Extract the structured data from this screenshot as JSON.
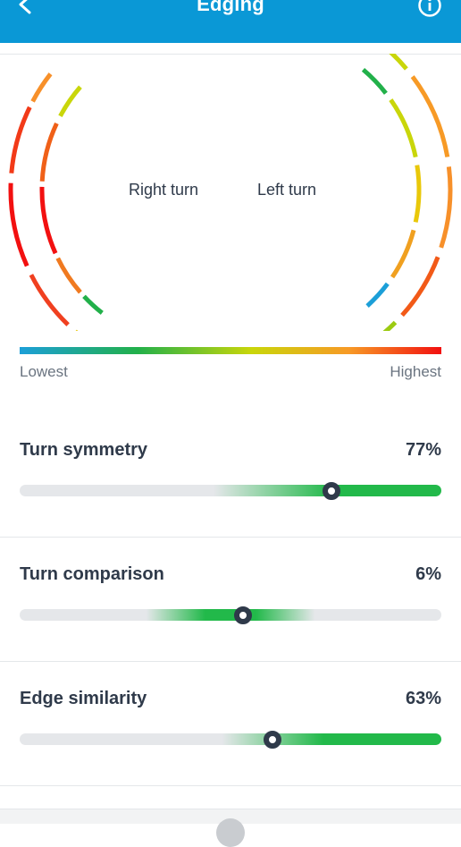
{
  "header": {
    "title": "Edging"
  },
  "gauge": {
    "right_label": "Right turn",
    "left_label": "Left turn"
  },
  "scale": {
    "low_label": "Lowest",
    "high_label": "Highest"
  },
  "metrics": [
    {
      "name": "Turn symmetry",
      "value": "77%",
      "marker_fraction": 0.74
    },
    {
      "name": "Turn comparison",
      "value": "6%",
      "marker_fraction": 0.53
    },
    {
      "name": "Edge similarity",
      "value": "63%",
      "marker_fraction": 0.6
    }
  ],
  "colors": {
    "header": "#0a98d6",
    "accent_green": "#22b94a",
    "track": "#e5e7ea",
    "scale": [
      "#1c9fd8",
      "#22b04a",
      "#c9d60a",
      "#f79a26",
      "#f21010"
    ]
  }
}
